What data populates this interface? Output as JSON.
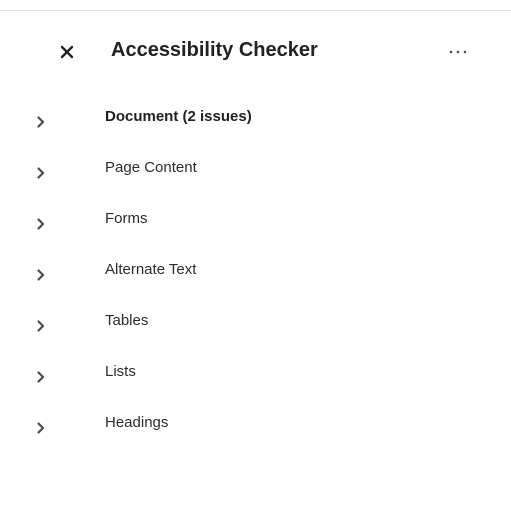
{
  "panel": {
    "title": "Accessibility Checker",
    "close_icon": "close-icon",
    "more_icon": "more-options-icon"
  },
  "categories": [
    {
      "label": "Document (2 issues)",
      "bold": true,
      "icon": "chevron-right-icon"
    },
    {
      "label": "Page Content",
      "bold": false,
      "icon": "chevron-right-icon"
    },
    {
      "label": "Forms",
      "bold": false,
      "icon": "chevron-right-icon"
    },
    {
      "label": "Alternate Text",
      "bold": false,
      "icon": "chevron-right-icon"
    },
    {
      "label": "Tables",
      "bold": false,
      "icon": "chevron-right-icon"
    },
    {
      "label": "Lists",
      "bold": false,
      "icon": "chevron-right-icon"
    },
    {
      "label": "Headings",
      "bold": false,
      "icon": "chevron-right-icon"
    }
  ],
  "colors": {
    "text": "#2c2c2c",
    "icon": "#4b4b4b",
    "divider": "#e1e1e1"
  }
}
